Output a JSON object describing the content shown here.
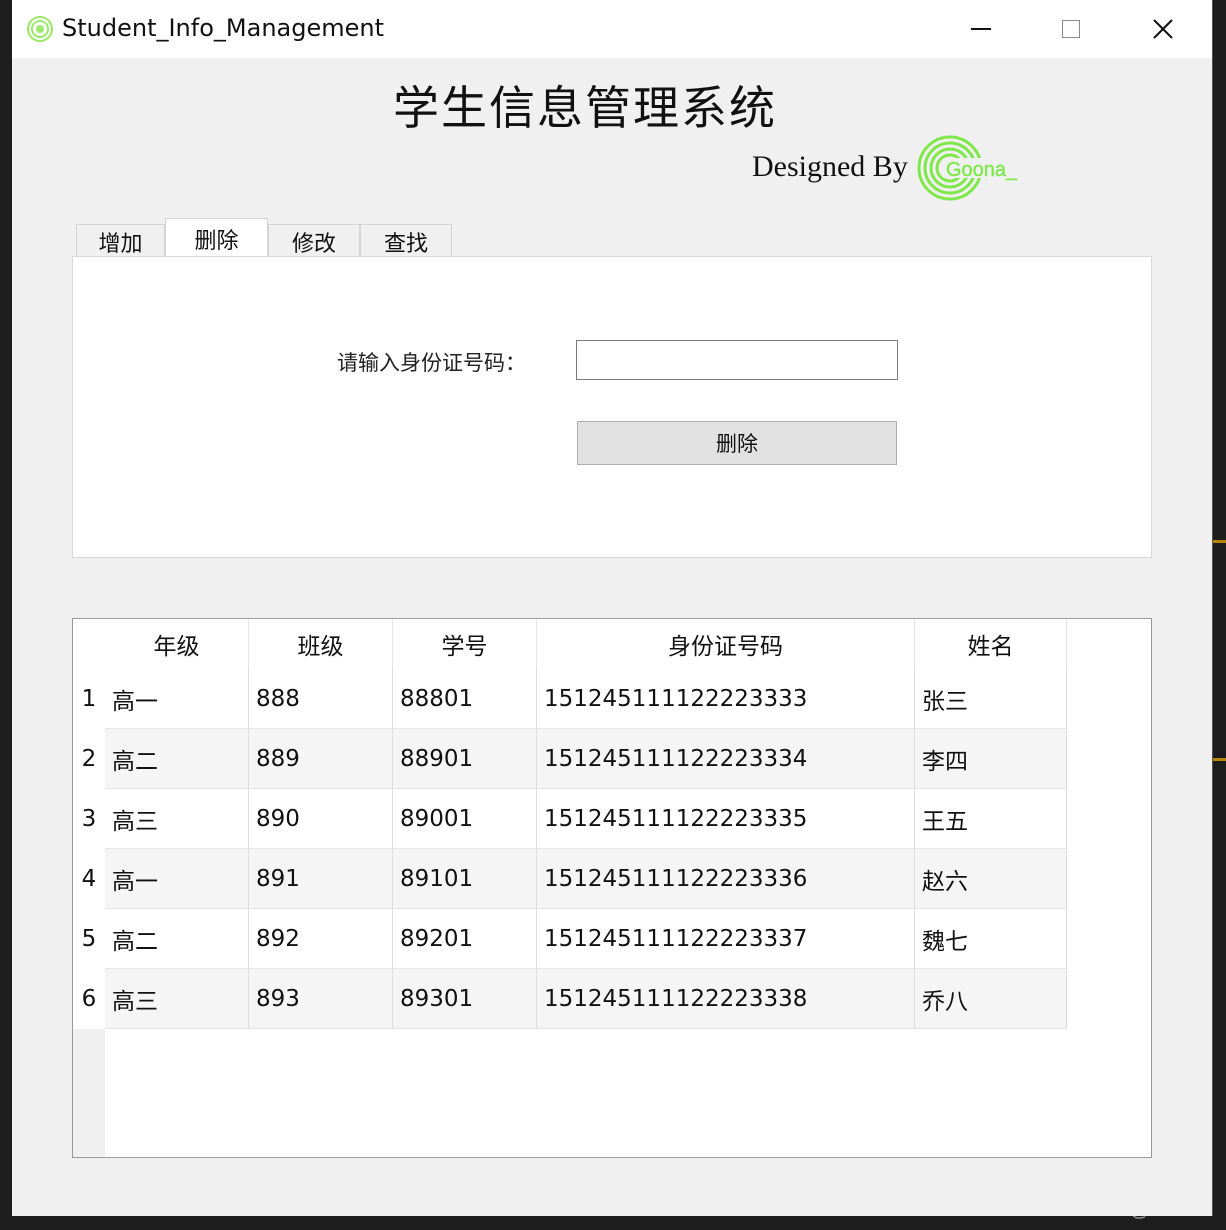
{
  "window": {
    "title": "Student_Info_Management"
  },
  "app": {
    "title": "学生信息管理系统",
    "designed_by": "Designed By",
    "brand_logo_name": "Goona logo",
    "brand_color": "#7ee84a"
  },
  "tabs": [
    {
      "label": "增加",
      "active": false
    },
    {
      "label": "删除",
      "active": true
    },
    {
      "label": "修改",
      "active": false
    },
    {
      "label": "查找",
      "active": false
    }
  ],
  "delete_panel": {
    "id_label": "请输入身份证号码：",
    "id_value": "",
    "delete_button": "删除"
  },
  "table": {
    "columns": [
      "年级",
      "班级",
      "学号",
      "身份证号码",
      "姓名"
    ],
    "rows": [
      {
        "num": "1",
        "grade": "高一",
        "class": "888",
        "student_id": "88801",
        "id_card": "151245111122223333",
        "name": "张三"
      },
      {
        "num": "2",
        "grade": "高二",
        "class": "889",
        "student_id": "88901",
        "id_card": "151245111122223334",
        "name": "李四"
      },
      {
        "num": "3",
        "grade": "高三",
        "class": "890",
        "student_id": "89001",
        "id_card": "151245111122223335",
        "name": "王五"
      },
      {
        "num": "4",
        "grade": "高一",
        "class": "891",
        "student_id": "89101",
        "id_card": "151245111122223336",
        "name": "赵六"
      },
      {
        "num": "5",
        "grade": "高二",
        "class": "892",
        "student_id": "89201",
        "id_card": "151245111122223337",
        "name": "魏七"
      },
      {
        "num": "6",
        "grade": "高三",
        "class": "893",
        "student_id": "89301",
        "id_card": "151245111122223338",
        "name": "乔八"
      }
    ]
  },
  "watermark": "CSDN @Goona"
}
